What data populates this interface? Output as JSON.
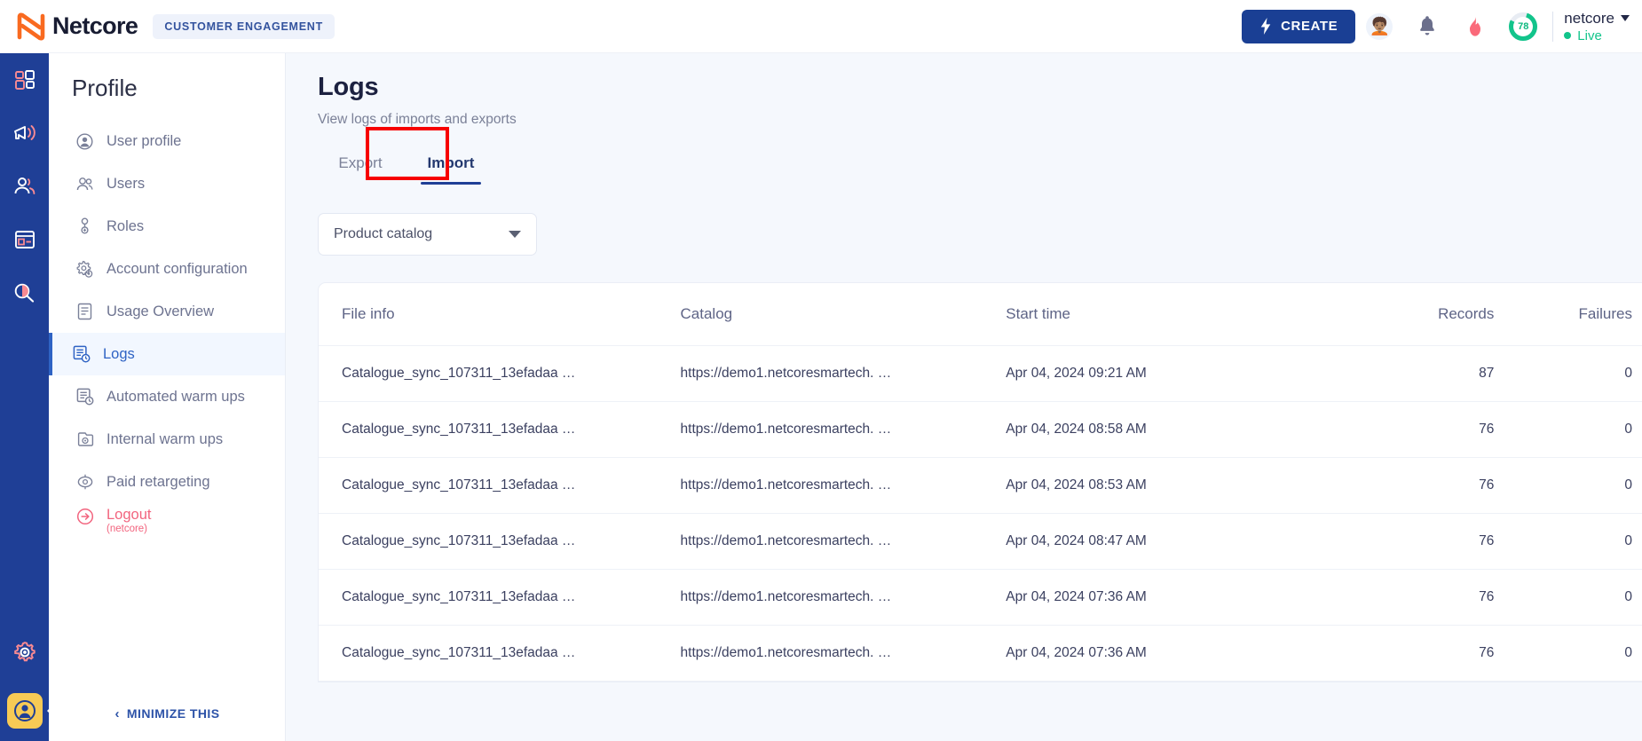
{
  "header": {
    "brand": "Netcore",
    "brand_tag": "CUSTOMER ENGAGEMENT",
    "create_label": "CREATE",
    "credit_score": "78",
    "account_name": "netcore",
    "status_label": "Live",
    "icons": [
      "avatar-icon",
      "bell-icon",
      "flame-icon",
      "score-ring-icon"
    ]
  },
  "rail": {
    "items": [
      {
        "name": "dashboard-icon"
      },
      {
        "name": "campaign-megaphone-icon"
      },
      {
        "name": "audience-users-icon"
      },
      {
        "name": "templates-page-icon"
      },
      {
        "name": "analytics-search-icon"
      }
    ],
    "settings": "settings-gear-icon",
    "profile": "profile-user-icon"
  },
  "sidebar": {
    "title": "Profile",
    "items": [
      {
        "label": "User profile",
        "icon": "user-profile-icon",
        "active": false
      },
      {
        "label": "Users",
        "icon": "users-icon",
        "active": false
      },
      {
        "label": "Roles",
        "icon": "roles-icon",
        "active": false
      },
      {
        "label": "Account configuration",
        "icon": "account-config-icon",
        "active": false
      },
      {
        "label": "Usage Overview",
        "icon": "usage-overview-icon",
        "active": false
      },
      {
        "label": "Logs",
        "icon": "logs-icon",
        "active": true
      },
      {
        "label": "Automated warm ups",
        "icon": "automated-warmups-icon",
        "active": false
      },
      {
        "label": "Internal warm ups",
        "icon": "internal-warmups-icon",
        "active": false
      },
      {
        "label": "Paid retargeting",
        "icon": "paid-retargeting-icon",
        "active": false
      }
    ],
    "logout": {
      "label": "Logout",
      "sub": "(netcore)",
      "icon": "logout-arrow-icon"
    },
    "minimize": "MINIMIZE THIS"
  },
  "main": {
    "title": "Logs",
    "subtitle": "View logs of imports and exports",
    "tabs": [
      {
        "label": "Export",
        "active": false
      },
      {
        "label": "Import",
        "active": true
      }
    ],
    "filter": {
      "selected": "Product catalog"
    },
    "table": {
      "columns": [
        "File info",
        "Catalog",
        "Start time",
        "Records",
        "Failures"
      ],
      "rows": [
        {
          "file": "Catalogue_sync_107311_13efadaa …",
          "catalog": "https://demo1.netcoresmartech. …",
          "start": "Apr 04, 2024 09:21 AM",
          "records": "87",
          "failures": "0"
        },
        {
          "file": "Catalogue_sync_107311_13efadaa …",
          "catalog": "https://demo1.netcoresmartech. …",
          "start": "Apr 04, 2024 08:58 AM",
          "records": "76",
          "failures": "0"
        },
        {
          "file": "Catalogue_sync_107311_13efadaa …",
          "catalog": "https://demo1.netcoresmartech. …",
          "start": "Apr 04, 2024 08:53 AM",
          "records": "76",
          "failures": "0"
        },
        {
          "file": "Catalogue_sync_107311_13efadaa …",
          "catalog": "https://demo1.netcoresmartech. …",
          "start": "Apr 04, 2024 08:47 AM",
          "records": "76",
          "failures": "0"
        },
        {
          "file": "Catalogue_sync_107311_13efadaa …",
          "catalog": "https://demo1.netcoresmartech. …",
          "start": "Apr 04, 2024 07:36 AM",
          "records": "76",
          "failures": "0"
        },
        {
          "file": "Catalogue_sync_107311_13efadaa …",
          "catalog": "https://demo1.netcoresmartech. …",
          "start": "Apr 04, 2024 07:36 AM",
          "records": "76",
          "failures": "0"
        }
      ]
    }
  },
  "colors": {
    "brand_orange": "#f96a20",
    "rail_blue": "#1f3f96",
    "primary_blue": "#1a3f94",
    "active_blue": "#2f63c4",
    "logout_pink": "#f2647e",
    "live_green": "#12c48b",
    "annotation_red": "#f70000",
    "profile_highlight": "#f7ca55"
  }
}
